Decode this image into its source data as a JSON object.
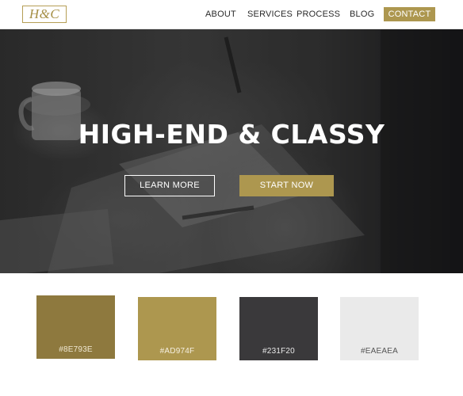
{
  "brand": {
    "logo_text": "H&C"
  },
  "nav": {
    "links": [
      "ABOUT",
      "SERVICES",
      "PROCESS",
      "BLOG"
    ],
    "contact_label": "CONTACT"
  },
  "hero": {
    "title": "HIGH-END & CLASSY",
    "learn_more_label": "LEARN MORE",
    "start_now_label": "START NOW"
  },
  "palette": [
    {
      "label": "#8E793E",
      "color": "#8E793E",
      "text_color": "#f0e8d2"
    },
    {
      "label": "#AD974F",
      "color": "#AD974F",
      "text_color": "#f5efe0"
    },
    {
      "label": "#231F20",
      "color": "#3a393b",
      "text_color": "#e8e8e8"
    },
    {
      "label": "#EAEAEA",
      "color": "#EAEAEA",
      "text_color": "#555555"
    }
  ],
  "colors": {
    "accent": "#AD974F",
    "text_dark": "#2a2a2a"
  }
}
